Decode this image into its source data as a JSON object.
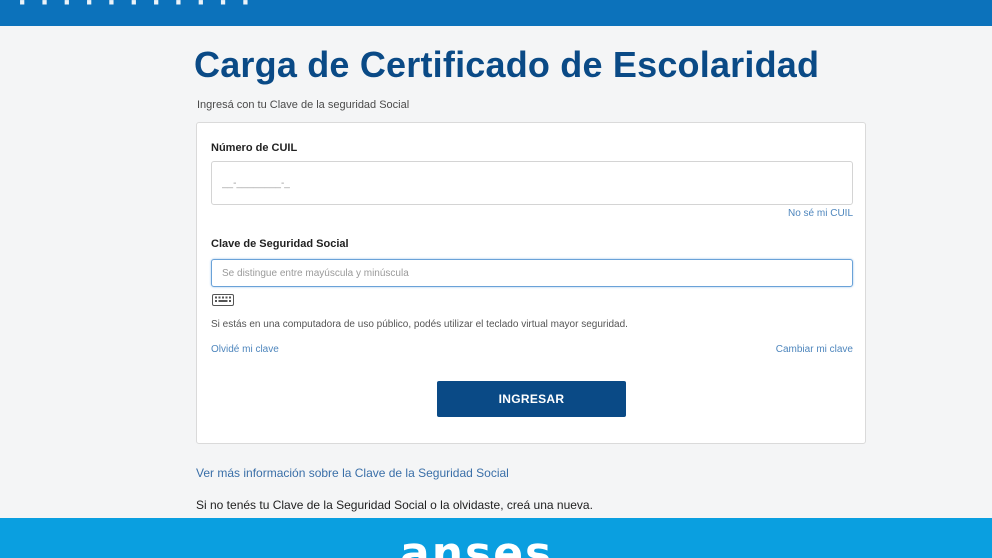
{
  "banner": {
    "partial_text": "· · ·  · ·  ·  · ·  · · ·"
  },
  "page": {
    "title": "Carga de Certificado de Escolaridad",
    "subtitle": "Ingresá con tu Clave de la seguridad Social"
  },
  "form": {
    "cuil_label": "Número de CUIL",
    "cuil_placeholder": "__-________-_",
    "no_se_cuil": "No sé mi CUIL",
    "password_label": "Clave de Seguridad Social",
    "password_placeholder": "Se distingue entre mayúscula y minúscula",
    "keyboard_icon": "keyboard-icon",
    "hint": "Si estás en una computadora de uso público, podés utilizar el teclado virtual mayor seguridad.",
    "forgot_link": "Olvidé mi clave",
    "change_link": "Cambiar mi clave",
    "submit_label": "INGRESAR"
  },
  "footer": {
    "info_link": "Ver más información sobre la Clave de la Seguridad Social",
    "note": "Si no tenés tu Clave de la Seguridad Social o la olvidaste, creá una nueva."
  },
  "brand": {
    "logo_text": "anses"
  },
  "colors": {
    "primary": "#0a4a86",
    "top_banner": "#0c72bb",
    "bottom_banner": "#0a9fe0",
    "link": "#4e86bd"
  }
}
